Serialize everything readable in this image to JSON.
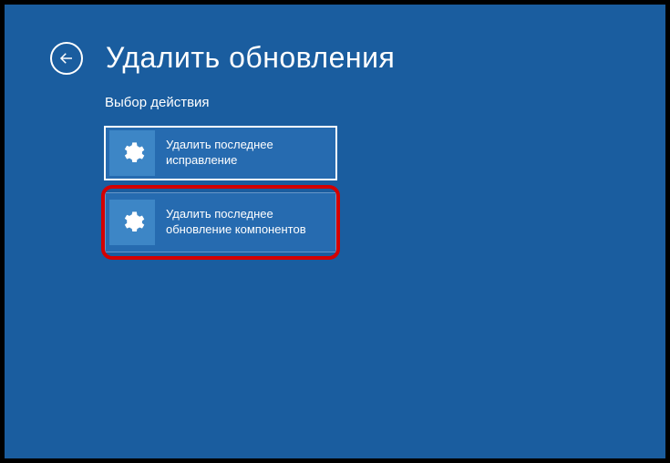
{
  "header": {
    "title": "Удалить обновления"
  },
  "subtitle": "Выбор действия",
  "options": [
    {
      "label": "Удалить последнее исправление"
    },
    {
      "label": "Удалить последнее обновление компонентов"
    }
  ]
}
